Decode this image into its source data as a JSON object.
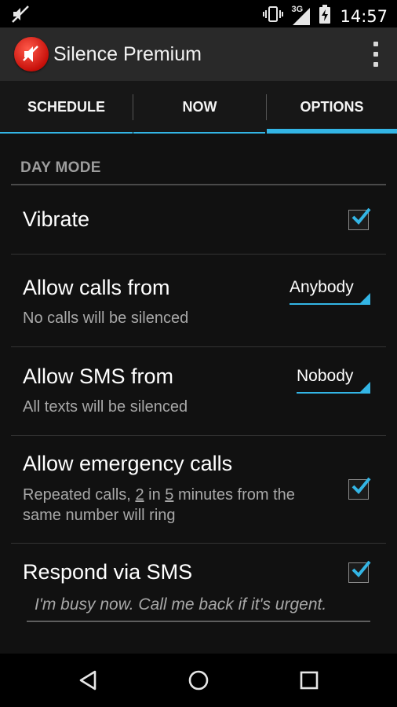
{
  "statusbar": {
    "time": "14:57",
    "network": "3G",
    "icons": [
      "silent-notification-icon",
      "vibrate-icon",
      "signal-3g-icon",
      "battery-icon"
    ]
  },
  "appbar": {
    "title": "Silence Premium",
    "icon": "silence-app-icon",
    "overflow_icon": "overflow-menu-icon"
  },
  "tabs": [
    {
      "label": "SCHEDULE",
      "active": false
    },
    {
      "label": "NOW",
      "active": false
    },
    {
      "label": "OPTIONS",
      "active": true
    }
  ],
  "section": {
    "title": "DAY MODE"
  },
  "settings": {
    "vibrate": {
      "title": "Vibrate",
      "checked": true
    },
    "calls": {
      "title": "Allow calls from",
      "subtitle": "No calls will be silenced",
      "value": "Anybody"
    },
    "sms": {
      "title": "Allow SMS from",
      "subtitle": "All texts will be silenced",
      "value": "Nobody"
    },
    "emergency": {
      "title": "Allow emergency calls",
      "sub_part1": "Repeated calls,",
      "count": "2",
      "sub_part2": "in",
      "minutes": "5",
      "sub_part3": "minutes from the",
      "sub_line2": "same number will ring",
      "checked": true
    },
    "respond": {
      "title": "Respond via SMS",
      "checked": true,
      "message": "I'm busy now. Call me back if it's urgent."
    }
  },
  "navbar": {
    "icons": [
      "back-icon",
      "home-icon",
      "recents-icon"
    ]
  },
  "colors": {
    "accent": "#33b5e5",
    "appbar": "#292929",
    "background": "#111111"
  }
}
